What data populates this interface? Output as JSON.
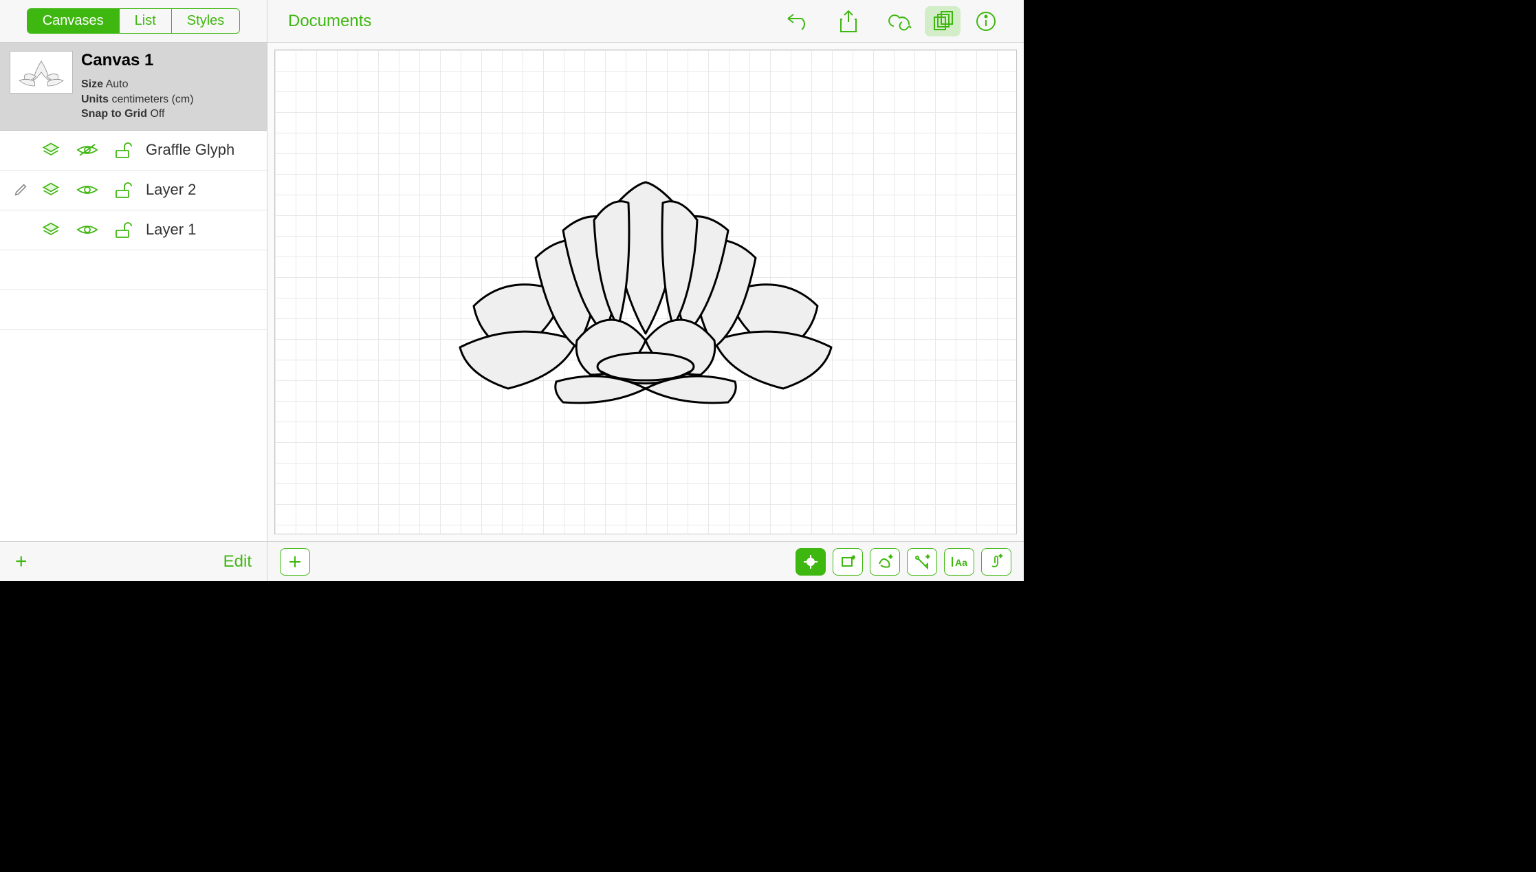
{
  "sidebar": {
    "tabs": {
      "canvases": "Canvases",
      "list": "List",
      "styles": "Styles",
      "active": "canvases"
    },
    "canvas": {
      "title": "Canvas 1",
      "size_label": "Size",
      "size_value": "Auto",
      "units_label": "Units",
      "units_value": "centimeters (cm)",
      "snap_label": "Snap to Grid",
      "snap_value": "Off"
    },
    "layers": [
      {
        "name": "Graffle Glyph",
        "visible": false,
        "locked": false,
        "editing": false
      },
      {
        "name": "Layer 2",
        "visible": true,
        "locked": false,
        "editing": true
      },
      {
        "name": "Layer 1",
        "visible": true,
        "locked": false,
        "editing": false
      }
    ],
    "footer": {
      "edit": "Edit"
    }
  },
  "topbar": {
    "documents": "Documents"
  },
  "colors": {
    "accent": "#3fb711"
  }
}
